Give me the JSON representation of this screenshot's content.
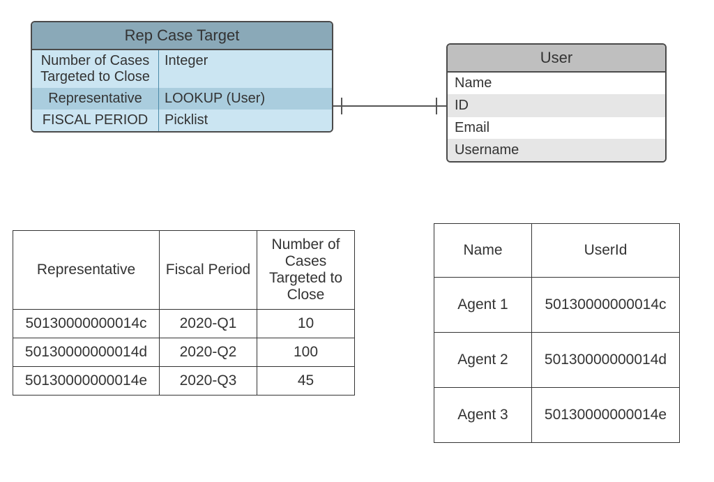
{
  "entities": {
    "rep": {
      "title": "Rep Case Target",
      "rows": [
        {
          "label": "Number of Cases Targeted to Close",
          "type": "Integer"
        },
        {
          "label": "Representative",
          "type": "LOOKUP (User)"
        },
        {
          "label": "FISCAL PERIOD",
          "type": "Picklist"
        }
      ]
    },
    "user": {
      "title": "User",
      "rows": [
        {
          "label": "Name"
        },
        {
          "label": "ID"
        },
        {
          "label": "Email"
        },
        {
          "label": "Username"
        }
      ]
    }
  },
  "dataTables": {
    "left": {
      "headers": [
        "Representative",
        "Fiscal Period",
        "Number of Cases Targeted to Close"
      ],
      "rows": [
        [
          "50130000000014c",
          "2020-Q1",
          "10"
        ],
        [
          "50130000000014d",
          "2020-Q2",
          "100"
        ],
        [
          "50130000000014e",
          "2020-Q3",
          "45"
        ]
      ]
    },
    "right": {
      "headers": [
        "Name",
        "UserId"
      ],
      "rows": [
        [
          "Agent 1",
          "50130000000014c"
        ],
        [
          "Agent 2",
          "50130000000014d"
        ],
        [
          "Agent 3",
          "50130000000014e"
        ]
      ]
    }
  }
}
